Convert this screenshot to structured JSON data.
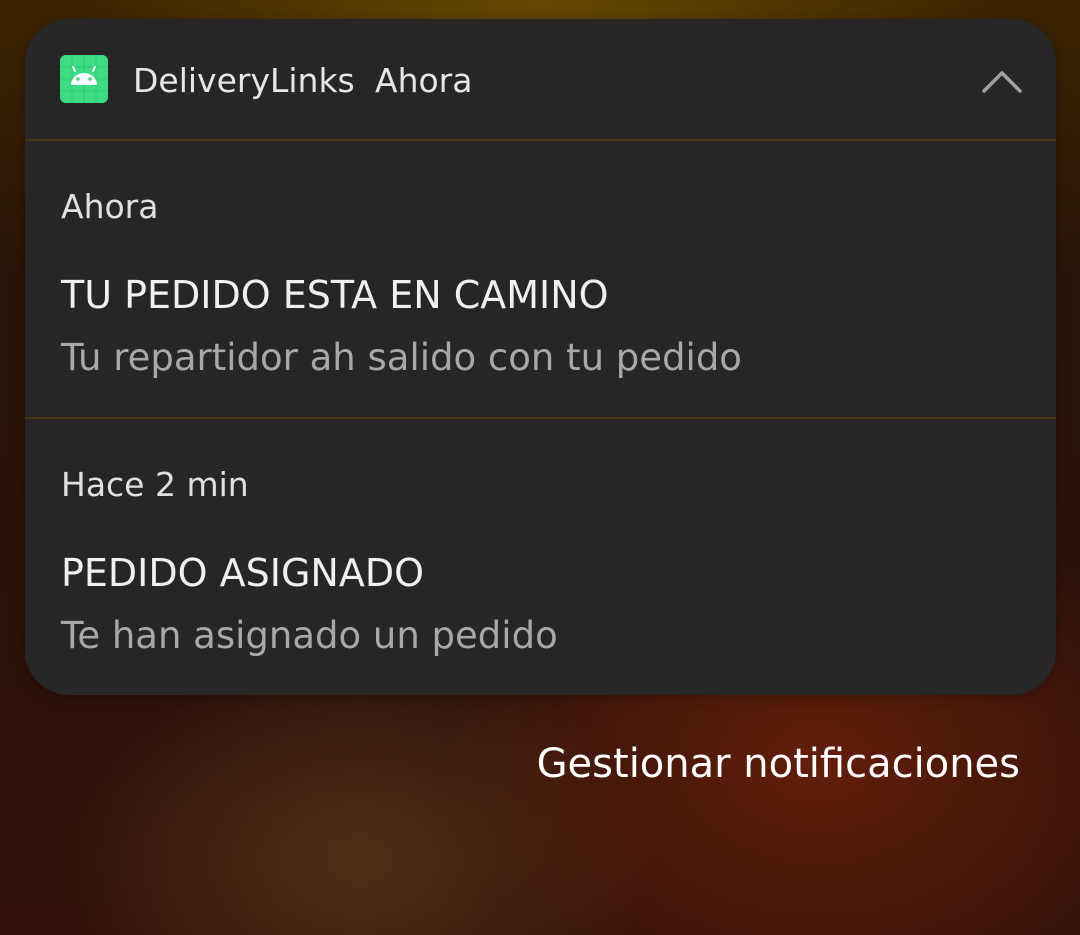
{
  "header": {
    "app_name": "DeliveryLinks",
    "time": "Ahora",
    "icon": "android-robot-icon",
    "icon_color": "#3ddc84",
    "collapse_icon": "chevron-up-icon"
  },
  "notifications": [
    {
      "time": "Ahora",
      "title": "TU PEDIDO ESTA EN CAMINO",
      "body": "Tu repartidor ah salido con tu pedido"
    },
    {
      "time": "Hace 2 min",
      "title": "PEDIDO ASIGNADO",
      "body": "Te han asignado un pedido"
    }
  ],
  "footer": {
    "manage_label": "Gestionar notificaciones"
  }
}
